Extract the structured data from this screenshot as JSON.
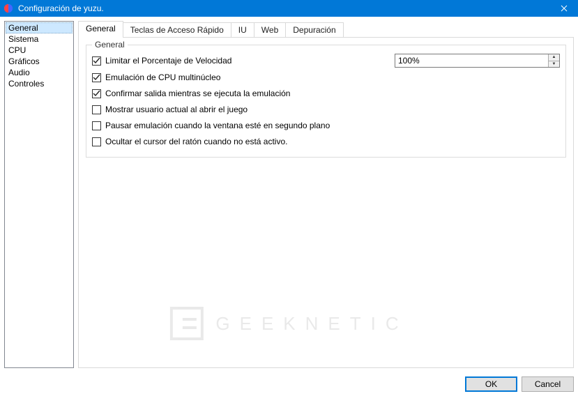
{
  "window": {
    "title": "Configuración de yuzu."
  },
  "sidebar": {
    "items": [
      {
        "label": "General",
        "selected": true
      },
      {
        "label": "Sistema",
        "selected": false
      },
      {
        "label": "CPU",
        "selected": false
      },
      {
        "label": "Gráficos",
        "selected": false
      },
      {
        "label": "Audio",
        "selected": false
      },
      {
        "label": "Controles",
        "selected": false
      }
    ]
  },
  "tabs": {
    "items": [
      {
        "label": "General",
        "active": true
      },
      {
        "label": "Teclas de Acceso Rápido",
        "active": false
      },
      {
        "label": "IU",
        "active": false
      },
      {
        "label": "Web",
        "active": false
      },
      {
        "label": "Depuración",
        "active": false
      }
    ]
  },
  "general_group": {
    "title": "General",
    "speed_value": "100%",
    "options": [
      {
        "label": "Limitar el Porcentaje de Velocidad",
        "checked": true,
        "has_input": true
      },
      {
        "label": "Emulación de CPU multinúcleo",
        "checked": true
      },
      {
        "label": "Confirmar salida mientras se ejecuta la emulación",
        "checked": true
      },
      {
        "label": "Mostrar usuario actual al abrir el juego",
        "checked": false
      },
      {
        "label": "Pausar emulación cuando la ventana esté en segundo plano",
        "checked": false
      },
      {
        "label": "Ocultar el cursor del ratón cuando no está activo.",
        "checked": false
      }
    ]
  },
  "footer": {
    "ok": "OK",
    "cancel": "Cancel"
  },
  "watermark": "GEEKNETIC"
}
